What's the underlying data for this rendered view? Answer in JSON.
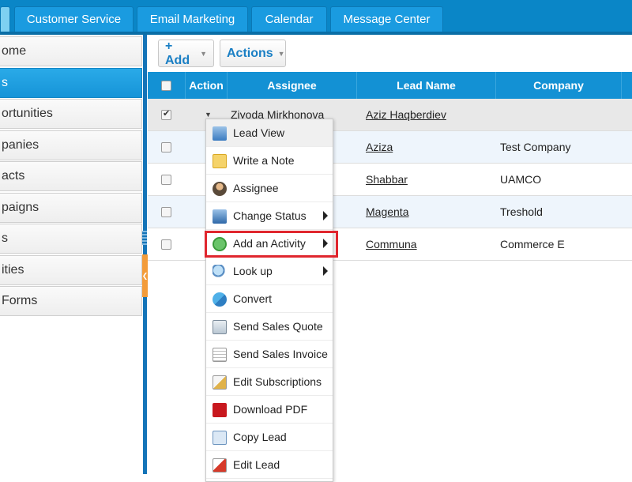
{
  "top_tabs": [
    "Customer Service",
    "Email Marketing",
    "Calendar",
    "Message Center"
  ],
  "sidebar": {
    "items": [
      {
        "label": "ome"
      },
      {
        "label": "s"
      },
      {
        "label": "ortunities"
      },
      {
        "label": "panies"
      },
      {
        "label": "acts"
      },
      {
        "label": "paigns"
      },
      {
        "label": "s"
      },
      {
        "label": "ities"
      },
      {
        "label": "Forms"
      }
    ]
  },
  "toolbar": {
    "add_label": "+ Add",
    "actions_label": "Actions"
  },
  "grid": {
    "headers": [
      "Action",
      "Assignee",
      "Lead Name",
      "Company"
    ],
    "rows": [
      {
        "assignee": "Ziyoda Mirkhonova",
        "lead_name": "Aziz Haqberdiev",
        "company": "",
        "checked": true
      },
      {
        "assignee": "",
        "lead_name": "Aziza",
        "company": "Test Company",
        "checked": false
      },
      {
        "assignee": "",
        "lead_name": "Shabbar",
        "company": "UAMCO",
        "checked": false
      },
      {
        "assignee": "",
        "lead_name": "Magenta",
        "company": "Treshold",
        "checked": false
      },
      {
        "assignee": "",
        "lead_name": "Communa",
        "company": "Commerce E",
        "checked": false
      }
    ]
  },
  "context_menu": {
    "items": [
      {
        "label": "Lead View",
        "icon": "lead-view-icon",
        "submenu": false
      },
      {
        "label": "Write a Note",
        "icon": "note-icon",
        "submenu": false
      },
      {
        "label": "Assignee",
        "icon": "assignee-icon",
        "submenu": false
      },
      {
        "label": "Change Status",
        "icon": "change-status-icon",
        "submenu": true
      },
      {
        "label": "Add an Activity",
        "icon": "add-activity-icon",
        "submenu": true
      },
      {
        "label": "Look up",
        "icon": "magnifier-icon",
        "submenu": true
      },
      {
        "label": "Convert",
        "icon": "convert-icon",
        "submenu": false
      },
      {
        "label": "Send Sales Quote",
        "icon": "sales-quote-icon",
        "submenu": false
      },
      {
        "label": "Send Sales Invoice",
        "icon": "sales-invoice-icon",
        "submenu": false
      },
      {
        "label": "Edit Subscriptions",
        "icon": "edit-subscriptions-icon",
        "submenu": false
      },
      {
        "label": "Download PDF",
        "icon": "pdf-icon",
        "submenu": false
      },
      {
        "label": "Copy Lead",
        "icon": "copy-icon",
        "submenu": false
      },
      {
        "label": "Edit Lead",
        "icon": "edit-icon",
        "submenu": false
      }
    ]
  },
  "colors": {
    "header_blue": "#1391d4",
    "tab_bar": "#0a86c7",
    "highlight_red": "#e0262e",
    "sidebar_active": "#1ea0e0"
  }
}
